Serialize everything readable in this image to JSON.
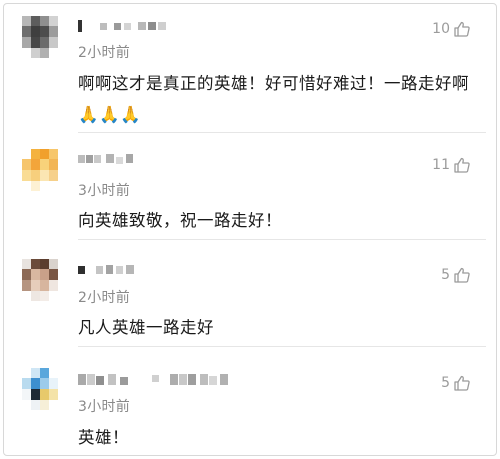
{
  "comments": [
    {
      "time": "2小时前",
      "likes": "10",
      "text": "啊啊这才是真正的英雄！好可惜好难过！一路走好啊🙏🙏🙏",
      "avatar_icon": "pixelated-avatar-gray",
      "name_icon": "pixelated-username"
    },
    {
      "time": "3小时前",
      "likes": "11",
      "text": "向英雄致敬，祝一路走好！",
      "avatar_icon": "pixelated-avatar-orange",
      "name_icon": "pixelated-username"
    },
    {
      "time": "2小时前",
      "likes": "5",
      "text": "凡人英雄一路走好",
      "avatar_icon": "pixelated-avatar-brown",
      "name_icon": "pixelated-username"
    },
    {
      "time": "3小时前",
      "likes": "5",
      "text": "英雄！",
      "avatar_icon": "pixelated-avatar-blue",
      "name_icon": "pixelated-username"
    }
  ],
  "icons": {
    "like": "thumbs-up-icon"
  },
  "colors": {
    "text": "#1a1a1a",
    "meta": "#8a8a8a",
    "divider": "#e6e6e6",
    "border": "#d8d8d8"
  }
}
